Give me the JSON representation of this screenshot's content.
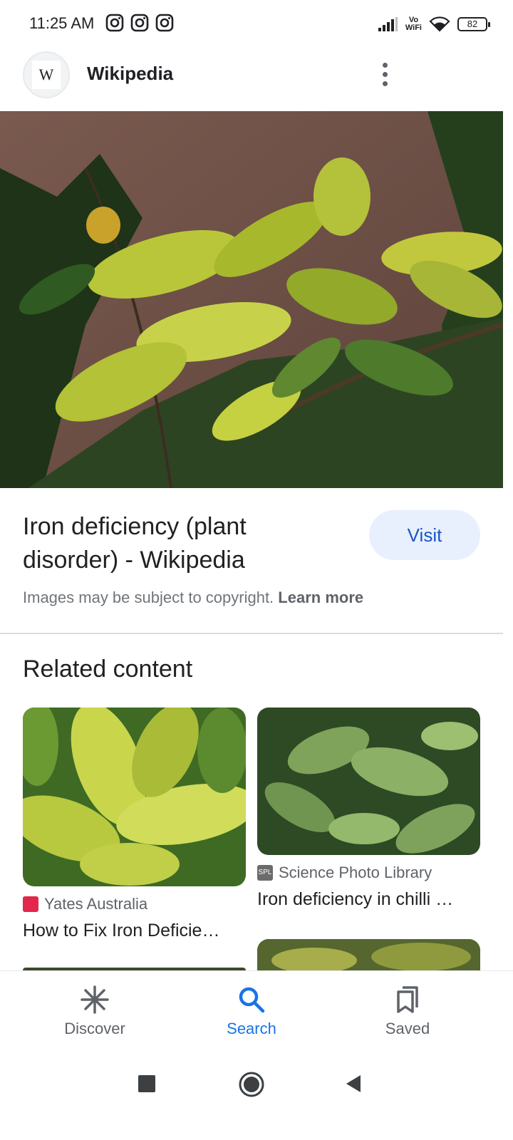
{
  "status_bar": {
    "time": "11:25 AM",
    "notification_icons": [
      "instagram-icon",
      "instagram-icon",
      "instagram-icon"
    ],
    "volte_label_1": "Vo",
    "volte_label_2": "WiFi",
    "battery": "82"
  },
  "header": {
    "site_logo_letter": "W",
    "site_name": "Wikipedia",
    "menu_icon": "more-vert-icon"
  },
  "result": {
    "title": "Iron deficiency (plant disorder) - Wikipedia",
    "visit_label": "Visit",
    "copyright_text": "Images may be subject to copyright.",
    "learn_more": "Learn more"
  },
  "related": {
    "heading": "Related content",
    "cards": [
      {
        "source": "Yates Australia",
        "title": "How to Fix Iron Deficie…",
        "source_icon_color": "#e2264d"
      },
      {
        "source": "Science Photo Library",
        "title": "Iron deficiency in chilli …",
        "source_icon_text": "SPL",
        "source_icon_color": "#6b6b6b"
      }
    ]
  },
  "bottom_nav": {
    "items": [
      {
        "label": "Discover",
        "icon": "asterisk-icon"
      },
      {
        "label": "Search",
        "icon": "search-icon"
      },
      {
        "label": "Saved",
        "icon": "bookmarks-icon"
      }
    ],
    "active": "Search",
    "active_color": "#1a73e8"
  },
  "system_nav": {
    "buttons": [
      "recents-square-icon",
      "home-circle-icon",
      "back-triangle-icon"
    ]
  }
}
